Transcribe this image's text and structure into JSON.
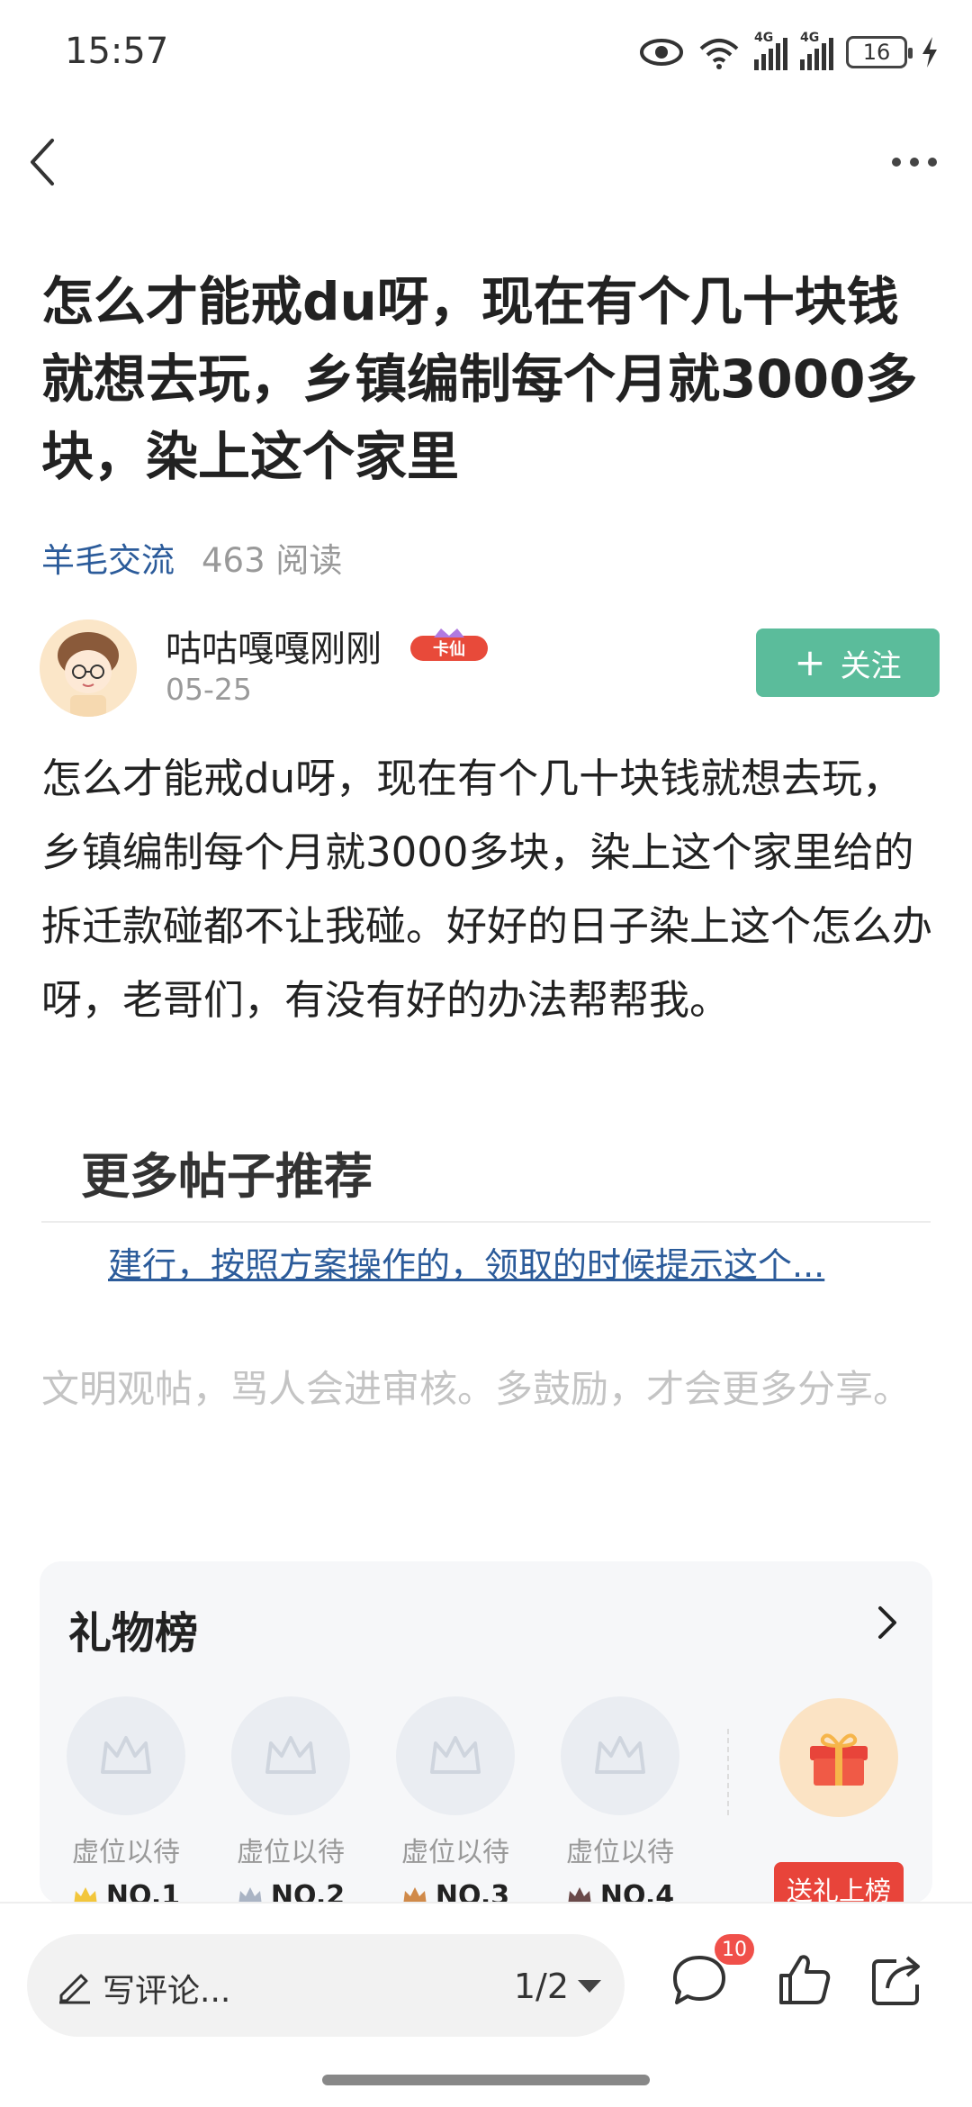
{
  "status_bar": {
    "time": "15:57",
    "net1": "4G",
    "net2": "4G",
    "battery": "16",
    "icons": [
      "eye-icon",
      "wifi-icon",
      "signal-icon",
      "signal-icon",
      "battery-icon",
      "charging-icon"
    ]
  },
  "nav": {
    "back_icon": "back-icon",
    "more_icon": "more-icon"
  },
  "post": {
    "title": "怎么才能戒du呀，现在有个几十块钱就想去玩，乡镇编制每个月就3000多块，染上这个家里",
    "category": "羊毛交流",
    "reads": "463 阅读",
    "author": {
      "name": "咕咕嘎嘎刚刚",
      "badge": "卡仙",
      "date": "05-25"
    },
    "follow_label": "关注",
    "body": "怎么才能戒du呀，现在有个几十块钱就想去玩，乡镇编制每个月就3000多块，染上这个家里给的拆迁款碰都不让我碰。好好的日子染上这个怎么办呀，老哥们，有没有好的办法帮帮我。"
  },
  "recommend": {
    "title": "更多帖子推荐",
    "items": [
      "建行，按照方案操作的，领取的时候提示这个..."
    ]
  },
  "comment_hint": "文明观帖，骂人会进审核。多鼓励，才会更多分享。",
  "gift_board": {
    "title": "礼物榜",
    "slots": [
      {
        "wait": "虚位以待",
        "rank": "NO.1"
      },
      {
        "wait": "虚位以待",
        "rank": "NO.2"
      },
      {
        "wait": "虚位以待",
        "rank": "NO.3"
      },
      {
        "wait": "虚位以待",
        "rank": "NO.4"
      }
    ],
    "send_label": "送礼上榜"
  },
  "bottom_bar": {
    "comment_placeholder": "写评论...",
    "page": "1/2",
    "comment_count": "10"
  },
  "colors": {
    "accent_green": "#5bbc9b",
    "link_blue": "#2b5b9a",
    "gift_red": "#e8443a",
    "badge_red": "#f0504a"
  }
}
